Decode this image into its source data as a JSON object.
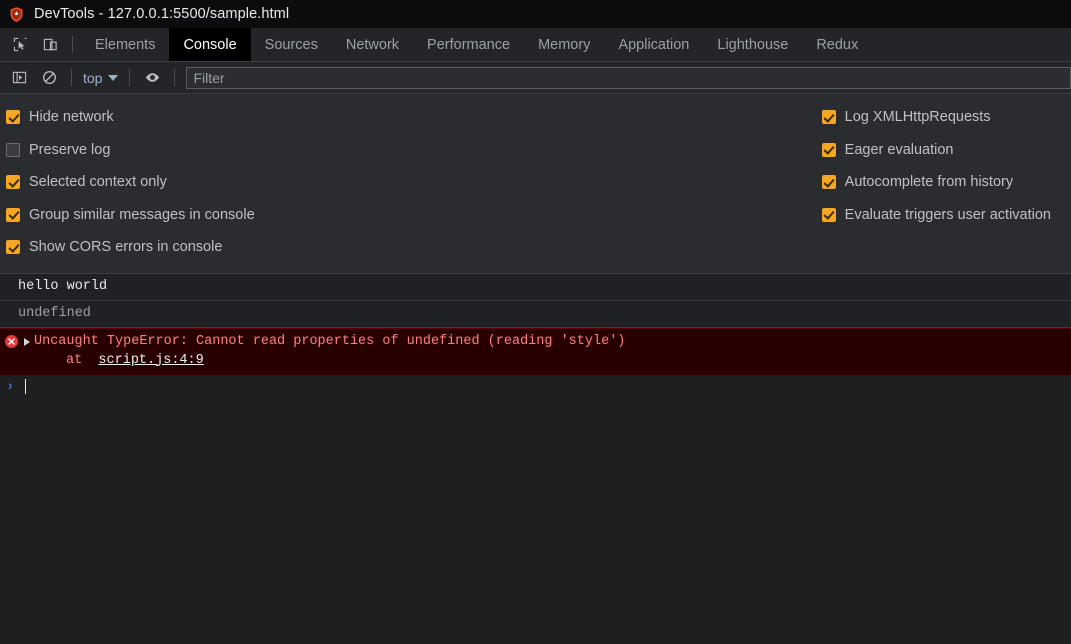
{
  "window": {
    "title": "DevTools - 127.0.0.1:5500/sample.html",
    "logo_icon": "brave-lion-icon"
  },
  "tabbar": {
    "inspect_icon": "inspect-element-icon",
    "device_icon": "device-toolbar-icon",
    "tabs": [
      {
        "label": "Elements",
        "active": false
      },
      {
        "label": "Console",
        "active": true
      },
      {
        "label": "Sources",
        "active": false
      },
      {
        "label": "Network",
        "active": false
      },
      {
        "label": "Performance",
        "active": false
      },
      {
        "label": "Memory",
        "active": false
      },
      {
        "label": "Application",
        "active": false
      },
      {
        "label": "Lighthouse",
        "active": false
      },
      {
        "label": "Redux",
        "active": false
      }
    ]
  },
  "toolbar": {
    "sidebar_icon": "console-sidebar-icon",
    "clear_icon": "clear-console-icon",
    "context_value": "top",
    "eye_icon": "live-expression-eye-icon",
    "filter_placeholder": "Filter",
    "filter_value": ""
  },
  "settings": {
    "left": [
      {
        "label": "Hide network",
        "checked": true
      },
      {
        "label": "Preserve log",
        "checked": false
      },
      {
        "label": "Selected context only",
        "checked": true
      },
      {
        "label": "Group similar messages in console",
        "checked": true
      },
      {
        "label": "Show CORS errors in console",
        "checked": true
      }
    ],
    "right": [
      {
        "label": "Log XMLHttpRequests",
        "checked": true
      },
      {
        "label": "Eager evaluation",
        "checked": true
      },
      {
        "label": "Autocomplete from history",
        "checked": true
      },
      {
        "label": "Evaluate triggers user activation",
        "checked": true
      }
    ]
  },
  "console": {
    "messages": [
      {
        "type": "log",
        "text": "hello world"
      },
      {
        "type": "result",
        "text": "undefined"
      }
    ],
    "error": {
      "icon": "error-circle-icon",
      "disclosure_icon": "disclosure-triangle-right-icon",
      "text": "Uncaught TypeError: Cannot read properties of undefined (reading 'style')",
      "at_label": "at",
      "source_link": "script.js:4:9"
    },
    "prompt_chevron": "›"
  },
  "colors": {
    "accent_checkbox": "#f5a623",
    "error_bg": "#290000",
    "error_text": "#ff8080",
    "panel_bg": "#2a2c2f",
    "console_bg": "#1e1f21",
    "active_tab_bg": "#000000",
    "prompt_blue": "#4a72c4"
  }
}
